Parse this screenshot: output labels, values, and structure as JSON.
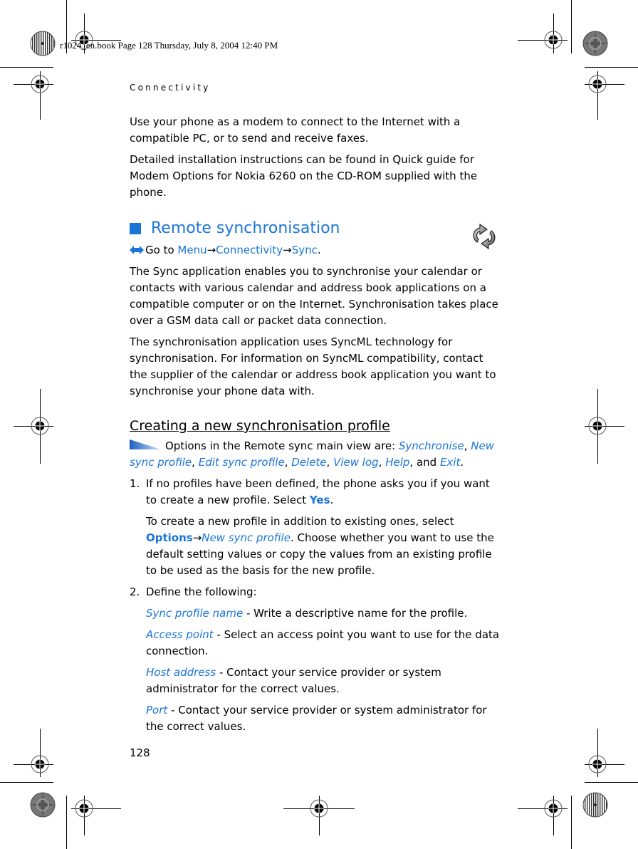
{
  "print_slug": "r1024_en.book  Page 128  Thursday, July 8, 2004  12:40 PM",
  "running_head": "Connectivity",
  "intro": {
    "p1": "Use your phone as a modem to connect to the Internet with a compatible PC, or to send and receive faxes.",
    "p2": "Detailed installation instructions can be found in Quick guide for Modem Options for Nokia 6260 on the CD-ROM supplied with the phone."
  },
  "section": {
    "title": "Remote synchronisation",
    "icon": "sync-arrows-icon",
    "goto": {
      "prefix": "Go to ",
      "menu": "Menu",
      "arrow": "→",
      "connectivity": "Connectivity",
      "sync": "Sync",
      "suffix": "."
    },
    "p1": "The Sync application enables you to synchronise your calendar or contacts with various calendar and address book applications on a compatible computer or on the Internet. Synchronisation takes place over a GSM data call or packet data connection.",
    "p2": "The synchronisation application uses SyncML technology for synchronisation. For information on SyncML compatibility, contact the supplier of the calendar or address book application you want to synchronise your phone data with."
  },
  "subsection": {
    "title": "Creating a new synchronisation profile",
    "options_intro": "Options in the Remote sync main view are: ",
    "options": [
      "Synchronise",
      "New sync profile",
      "Edit sync profile",
      "Delete",
      "View log",
      "Help",
      "Exit"
    ],
    "sep": ", ",
    "and": ", and ",
    "end": ".",
    "steps": [
      {
        "num": "1.",
        "text_a": "If no profiles have been defined, the phone asks you if you want to create a new profile. Select ",
        "yes": "Yes",
        "text_b": ".",
        "para2_a": "To create a new profile in addition to existing ones, select ",
        "options_label": "Options",
        "arrow": "→",
        "new_sync": "New sync profile",
        "para2_b": ". Choose whether you want to use the default setting values or copy the values from an existing profile to be used as the basis for the new profile."
      },
      {
        "num": "2.",
        "text": "Define the following:",
        "fields": [
          {
            "name": "Sync profile name",
            "desc": " - Write a descriptive name for the profile."
          },
          {
            "name": "Access point",
            "desc": " - Select an access point you want to use for the data connection."
          },
          {
            "name": "Host address",
            "desc": " - Contact your service provider or system administrator for the correct values."
          },
          {
            "name": "Port",
            "desc": " - Contact your service provider or system administrator for the correct values."
          }
        ]
      }
    ]
  },
  "page_number": "128",
  "colors": {
    "accent": "#1a75d9",
    "text": "#000000"
  }
}
